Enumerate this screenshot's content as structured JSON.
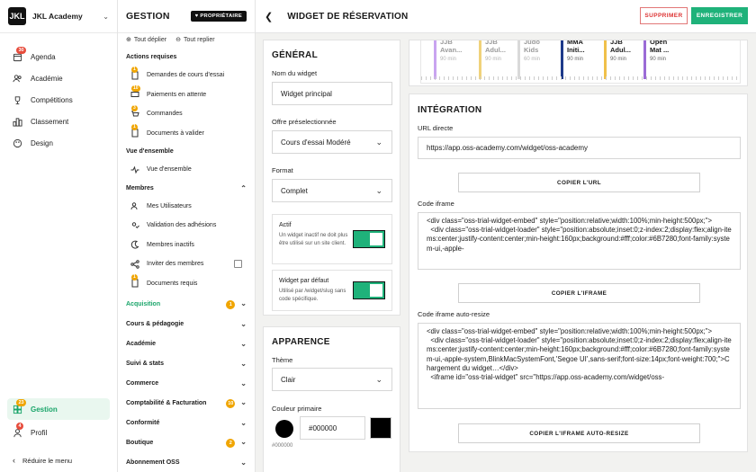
{
  "sidebar": {
    "brand_logo": "JKL",
    "brand_name": "JKL Academy",
    "items": [
      {
        "label": "Agenda",
        "icon": "calendar-icon",
        "badge": "30"
      },
      {
        "label": "Académie",
        "icon": "users-icon"
      },
      {
        "label": "Compétitions",
        "icon": "trophy-icon"
      },
      {
        "label": "Classement",
        "icon": "ranking-icon"
      },
      {
        "label": "Design",
        "icon": "palette-icon"
      }
    ],
    "bottom": [
      {
        "label": "Gestion",
        "icon": "settings-icon",
        "badge": "23"
      },
      {
        "label": "Profil",
        "icon": "user-icon",
        "badge": "4"
      }
    ],
    "collapse_label": "Réduire le menu"
  },
  "gestion": {
    "title": "GESTION",
    "owner_tag": "PROPRIÉTAIRE",
    "expand_all": "Tout déplier",
    "collapse_all": "Tout replier",
    "actions_title": "Actions requises",
    "actions": [
      {
        "label": "Demandes de cours d'essai",
        "badge": "1"
      },
      {
        "label": "Paiements en attente",
        "badge": "10"
      },
      {
        "label": "Commandes",
        "badge": "3"
      },
      {
        "label": "Documents à valider",
        "badge": "1"
      }
    ],
    "overview_title": "Vue d'ensemble",
    "overview_item": "Vue d'ensemble",
    "members_title": "Membres",
    "members": [
      {
        "label": "Mes Utilisateurs"
      },
      {
        "label": "Validation des adhésions"
      },
      {
        "label": "Membres inactifs"
      },
      {
        "label": "Inviter des membres"
      },
      {
        "label": "Documents requis",
        "badge": "1"
      }
    ],
    "sections": [
      {
        "label": "Acquisition",
        "badge": "1"
      },
      {
        "label": "Cours & pédagogie"
      },
      {
        "label": "Académie"
      },
      {
        "label": "Suivi & stats"
      },
      {
        "label": "Commerce"
      },
      {
        "label": "Comptabilité & Facturation",
        "badge": "10"
      },
      {
        "label": "Conformité"
      },
      {
        "label": "Boutique",
        "badge": "2"
      },
      {
        "label": "Abonnement OSS"
      }
    ]
  },
  "main": {
    "title": "WIDGET DE RÉSERVATION",
    "delete_label": "SUPPRIMER",
    "save_label": "ENREGISTRER",
    "general": {
      "title": "GÉNÉRAL",
      "name_label": "Nom du widget",
      "name_value": "Widget principal",
      "offer_label": "Offre préselectionnée",
      "offer_value": "Cours d'essai Modéré",
      "format_label": "Format",
      "format_value": "Complet",
      "active_title": "Actif",
      "active_desc": "Un widget inactif ne doit plus être utilisé sur un site client.",
      "default_title": "Widget par défaut",
      "default_desc": "Utilisé par /widget/slug sans code spécifique.",
      "active_on": true,
      "default_on": true
    },
    "appearance": {
      "title": "APPARENCE",
      "theme_label": "Thème",
      "theme_value": "Clair",
      "color_label": "Couleur primaire",
      "color_value": "#000000",
      "color_hint": "#000000"
    },
    "preview_classes": [
      {
        "name": "JJB Avan...",
        "duration": "90 min",
        "color": "#c9a4f0",
        "dim": true
      },
      {
        "name": "JJB Adul...",
        "duration": "90 min",
        "color": "#f0d27a",
        "dim": true
      },
      {
        "name": "Judo Kids",
        "duration": "60 min",
        "color": "#d9d9d9",
        "dim": true
      },
      {
        "name": "MMA Initi...",
        "duration": "90 min",
        "color": "#1e3a8a",
        "dim": false
      },
      {
        "name": "JJB Adul...",
        "duration": "90 min",
        "color": "#f0c04a",
        "dim": false
      },
      {
        "name": "Open Mat ...",
        "duration": "90 min",
        "color": "#9b6bd6",
        "dim": false
      }
    ],
    "integration": {
      "title": "INTÉGRATION",
      "url_label": "URL directe",
      "url_value": "https://app.oss-academy.com/widget/oss-academy",
      "copy_url": "COPIER L'URL",
      "iframe_label": "Code iframe",
      "iframe_code": "<div class=\"oss-trial-widget-embed\" style=\"position:relative;width:100%;min-height:500px;\">\n  <div class=\"oss-trial-widget-loader\" style=\"position:absolute;inset:0;z-index:2;display:flex;align-items:center;justify-content:center;min-height:160px;background:#fff;color:#6B7280;font-family:system-ui,-apple-",
      "copy_iframe": "COPIER L'IFRAME",
      "resize_label": "Code iframe auto-resize",
      "resize_code": "<div class=\"oss-trial-widget-embed\" style=\"position:relative;width:100%;min-height:500px;\">\n  <div class=\"oss-trial-widget-loader\" style=\"position:absolute;inset:0;z-index:2;display:flex;align-items:center;justify-content:center;min-height:160px;background:#fff;color:#6B7280;font-family:system-ui,-apple-system,BlinkMacSystemFont,'Segoe UI',sans-serif;font-size:14px;font-weight:700;\">Chargement du widget…</div>\n  <iframe id=\"oss-trial-widget\" src=\"https://app.oss-academy.com/widget/oss-",
      "copy_resize": "COPIER L'IFRAME AUTO-RESIZE"
    }
  },
  "colors": {
    "accent": "#1fb27a",
    "danger": "#d33333",
    "badge_orange": "#f0a500",
    "badge_red": "#e74c3c"
  }
}
